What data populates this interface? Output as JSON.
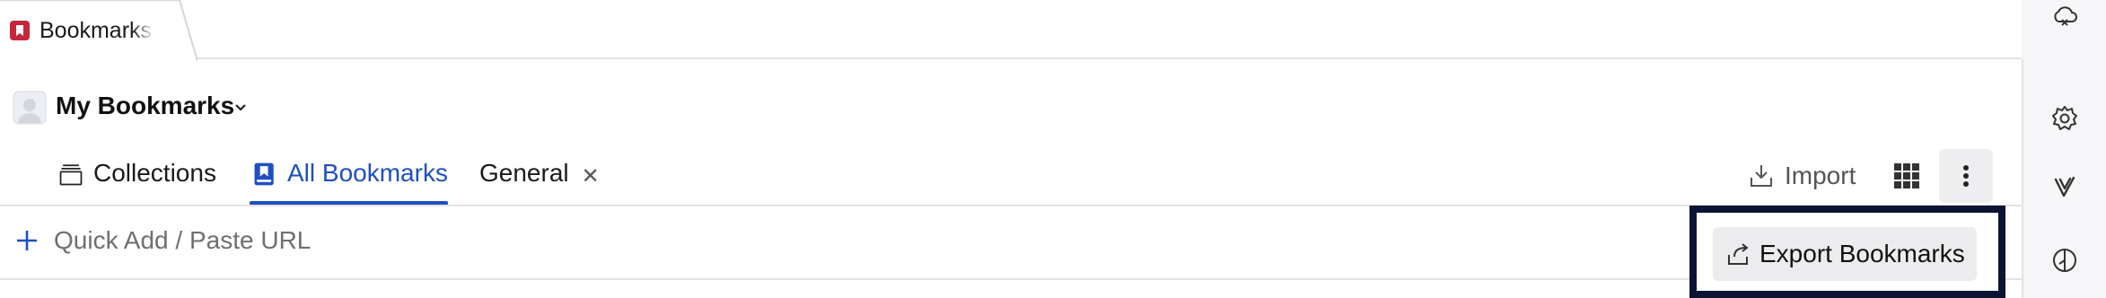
{
  "browser_tab": {
    "title": "Bookmarks",
    "favicon": "bookmark-icon"
  },
  "header": {
    "account_name": "My Bookmarks",
    "tabs": [
      {
        "label": "Collections",
        "icon": "collections-icon",
        "active": false
      },
      {
        "label": "All Bookmarks",
        "icon": "bookmark-book-icon",
        "active": true
      },
      {
        "label": "General",
        "closable": true,
        "close_glyph": "✕",
        "active": false
      }
    ],
    "import_label": "Import"
  },
  "quick_add": {
    "placeholder": "Quick Add / Paste URL"
  },
  "menu": {
    "export_label": "Export Bookmarks"
  },
  "right_panel": {
    "icons": [
      "cloud-sync-icon",
      "settings-icon",
      "vivaldi-icon",
      "compass-icon"
    ]
  },
  "colors": {
    "accent": "#1f4fc1",
    "favicon": "#c7273a",
    "highlight_frame": "#0b1433"
  }
}
